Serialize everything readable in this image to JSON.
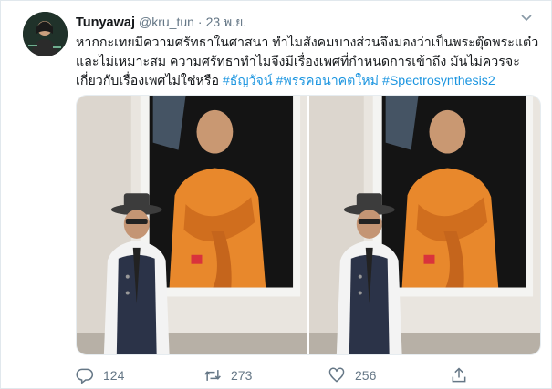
{
  "tweet": {
    "display_name": "Tunyawaj",
    "handle": "@kru_tun",
    "separator": "·",
    "timestamp": "23 พ.ย.",
    "text_line1": "หากกะเทยมีความศรัทธาในศาสนา ทำไมสังคมบางส่วนจึงมองว่าเป็นพระตุ๊ดพระแต๋ว",
    "text_line2": "และไม่เหมาะสม ความศรัทธาทำไมจึงมีเรื่องเพศที่กำหนดการเข้าถึง มันไม่ควรจะ",
    "text_line3_plain": "เกี่ยวกับเรื่องเพศไม่ใช่หรือ ",
    "hashtags": [
      "#ธัญวัจน์",
      "#พรรคอนาคตใหม่",
      "#Spectrosynthesis2"
    ]
  },
  "media": {
    "photo_count": 2
  },
  "actions": {
    "reply_count": "124",
    "retweet_count": "273",
    "like_count": "256"
  },
  "icons": {
    "reply": "reply-icon",
    "retweet": "retweet-icon",
    "like": "heart-icon",
    "share": "share-icon",
    "caret": "chevron-down-icon"
  },
  "colors": {
    "link": "#1b95e0",
    "muted": "#657786",
    "robe": "#e8882c"
  }
}
